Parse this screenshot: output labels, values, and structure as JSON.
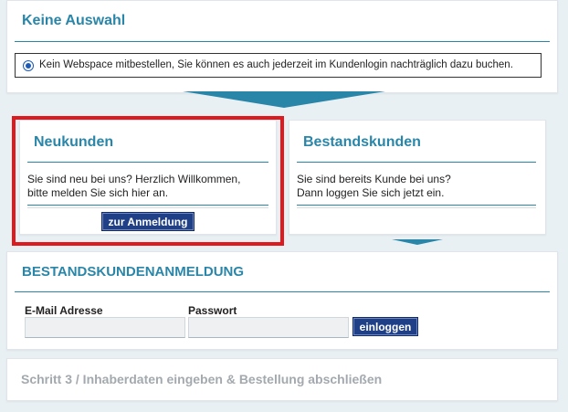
{
  "webspace": {
    "heading": "Keine Auswahl",
    "option_text": "Kein Webspace mitbestellen, Sie können es auch jederzeit im Kundenlogin nachträglich dazu buchen."
  },
  "new_customers": {
    "heading": "Neukunden",
    "line1": "Sie sind neu bei uns? Herzlich Willkommen,",
    "line2": "bitte melden Sie sich hier an.",
    "button": "zur Anmeldung"
  },
  "existing_customers": {
    "heading": "Bestandskunden",
    "line1": "Sie sind bereits Kunde bei uns?",
    "line2": "Dann loggen Sie sich jetzt ein."
  },
  "login": {
    "heading": "BESTANDSKUNDENANMELDUNG",
    "email_label": "E-Mail Adresse",
    "password_label": "Passwort",
    "button": "einloggen"
  },
  "step3": {
    "heading": "Schritt 3 / Inhaberdaten eingeben & Bestellung abschließen"
  },
  "colors": {
    "accent": "#2a86a8",
    "button": "#1f3f86",
    "highlight": "#e0191f"
  }
}
